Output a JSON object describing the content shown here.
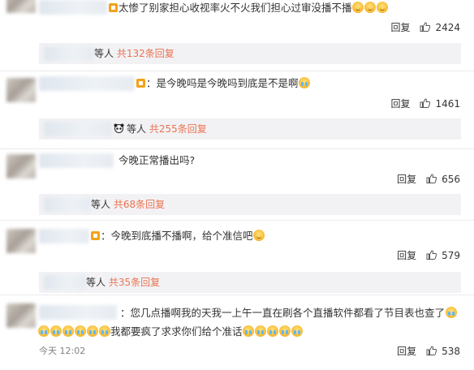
{
  "comments": [
    {
      "segments": [
        "太惨了别家担心收视率火不火我们担心过审没播不播"
      ],
      "emojis": [
        "smile",
        "smile",
        "smile"
      ],
      "reply_label": "回复",
      "likes": "2424",
      "sub": {
        "suffix": "等人",
        "link": "共132条回复"
      }
    },
    {
      "segments": [
        "：是今晚吗是今晚吗到底是不是啊"
      ],
      "emojis": [
        "cry"
      ],
      "reply_label": "回复",
      "likes": "1461",
      "sub": {
        "suffix": "等人",
        "link": "共255条回复"
      }
    },
    {
      "segments": [
        "今晚正常播出吗?"
      ],
      "reply_label": "回复",
      "likes": "656",
      "sub": {
        "suffix": "等人",
        "link": "共68条回复"
      }
    },
    {
      "segments": [
        "：今晚到底播不播啊，给个准信吧"
      ],
      "emojis": [
        "smile"
      ],
      "reply_label": "回复",
      "likes": "579",
      "sub": {
        "suffix": "等人",
        "link": "共35条回复"
      }
    },
    {
      "segments": [
        "：您几点播啊我的天我一上午一直在刷各个直播软件都看了节目表也查了",
        "我都要疯了求求你们给个准话"
      ],
      "reply_label": "回复",
      "likes": "538",
      "time": "今天 12:02"
    }
  ]
}
